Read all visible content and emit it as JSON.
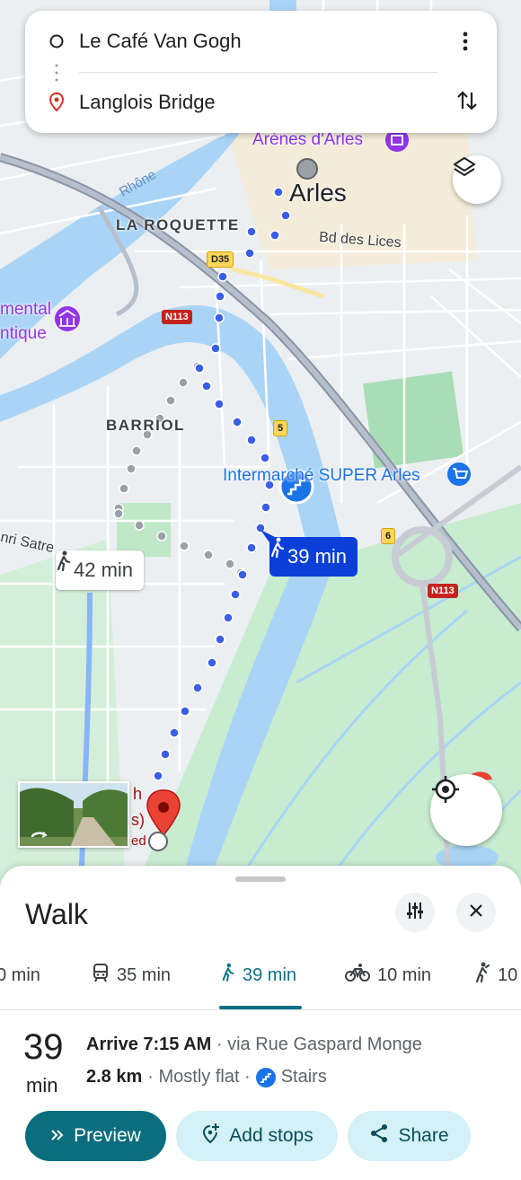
{
  "route": {
    "origin": "Le Café Van Gogh",
    "destination": "Langlois Bridge"
  },
  "map": {
    "labels": {
      "city": "Arles",
      "arenes": "Arènes d'Arles",
      "la_roquette": "LA ROQUETTE",
      "bd_lices": "Bd des Lices",
      "barriol": "BARRIOL",
      "river": "Rhône",
      "museum_line1": "mental",
      "museum_line2": "ntique",
      "intermarche": "Intermarché SUPER Arles",
      "henri_satre": "nri Satre",
      "partial_h": "h",
      "partial_s": "s)",
      "partial_ed": "ed"
    },
    "road_shields": {
      "d35": "D35",
      "n113_top": "N113",
      "n113_bottom": "N113",
      "r5": "5",
      "r6": "6"
    },
    "alt_route_time": "42 min",
    "selected_route_time": "39 min",
    "colors": {
      "route_dots": "#3b5ee6",
      "alt_route_dots": "#9aa0a6",
      "water": "#a9d4f5",
      "park": "#bfe8c8",
      "destination_pin": "#ea4335"
    }
  },
  "sheet": {
    "title": "Walk",
    "modes": [
      {
        "icon": "car-icon",
        "label": "0 min"
      },
      {
        "icon": "transit-icon",
        "label": "35 min"
      },
      {
        "icon": "walk-icon",
        "label": "39 min",
        "active": true
      },
      {
        "icon": "bike-icon",
        "label": "10 min"
      },
      {
        "icon": "scooter-icon",
        "label": "10"
      }
    ],
    "duration_value": "39",
    "duration_unit": "min",
    "arrive": "Arrive 7:15 AM",
    "via": " · via Rue Gaspard Monge",
    "distance": "2.8 km",
    "terrain": " · Mostly flat · ",
    "stairs": "Stairs",
    "buttons": {
      "preview": "Preview",
      "add_stops": "Add stops",
      "share": "Share"
    }
  }
}
